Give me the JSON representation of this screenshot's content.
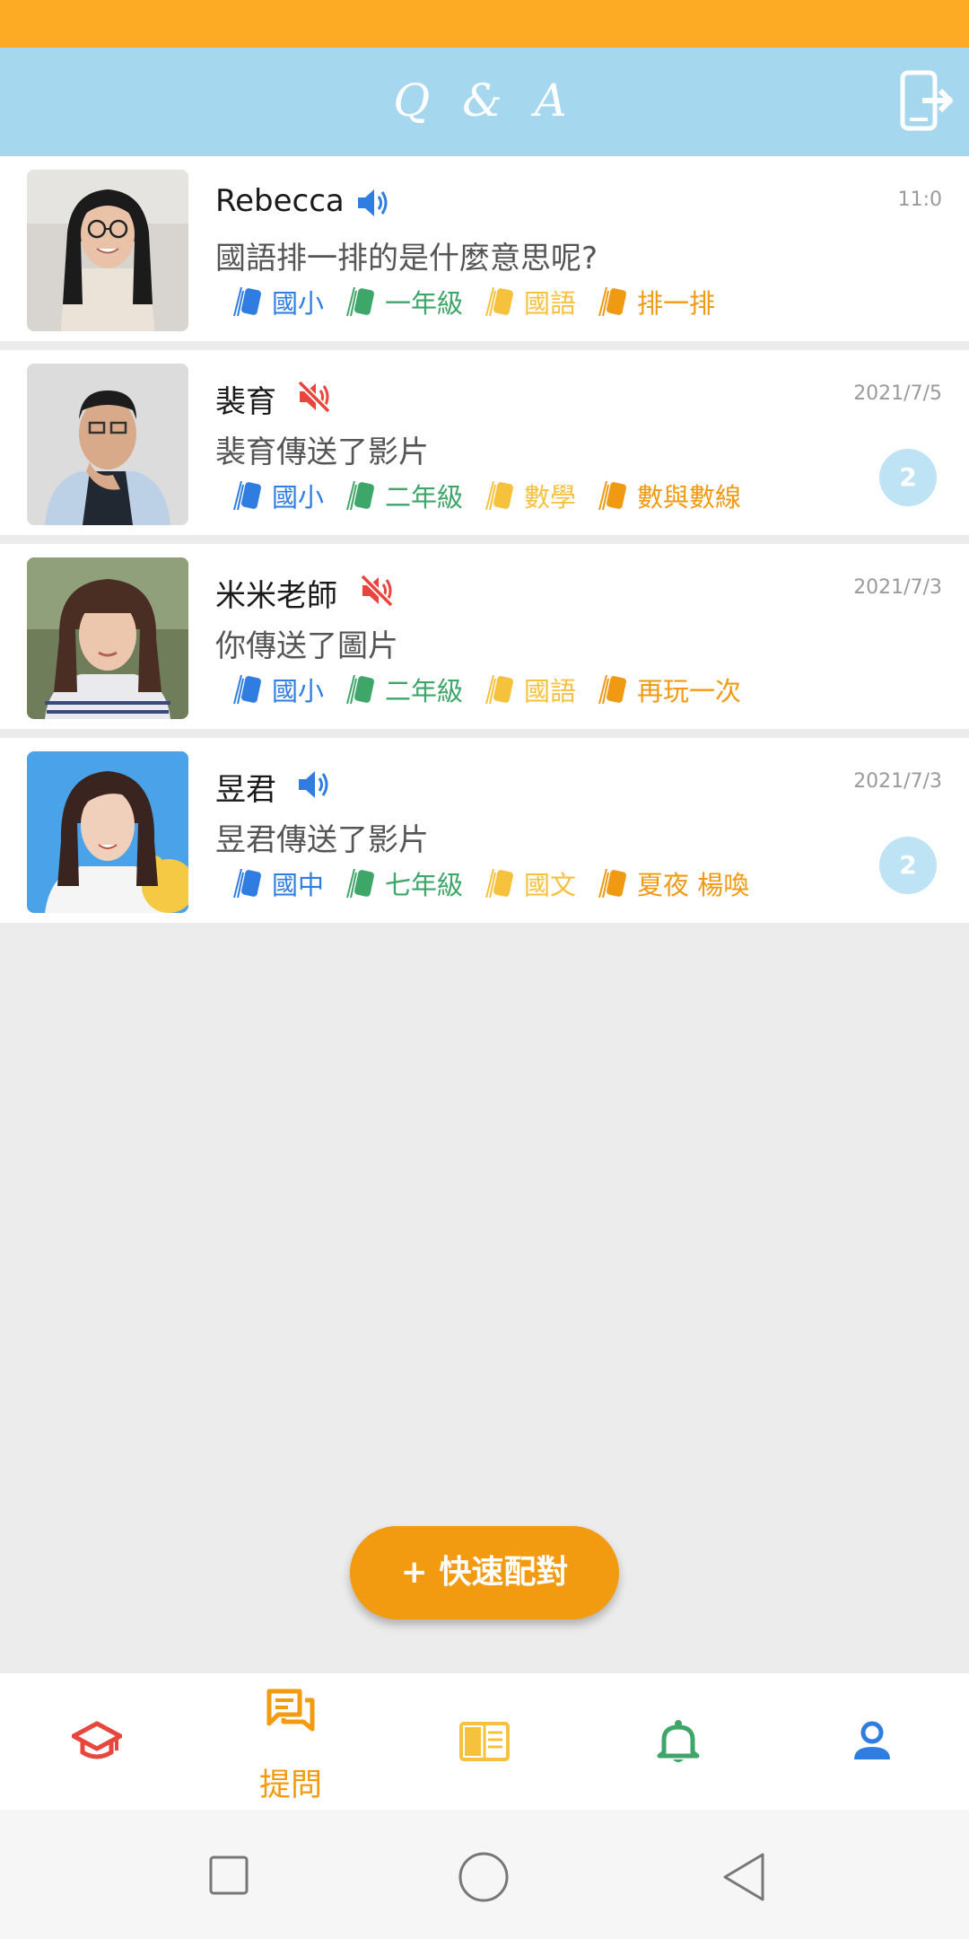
{
  "header": {
    "title": "Q & A"
  },
  "chats": [
    {
      "name": "Rebecca",
      "sound": "sound-on",
      "time": "11:0",
      "preview": "國語排一排的是什麼意思呢?",
      "tags": [
        "國小",
        "一年級",
        "國語",
        "排一排"
      ],
      "badge": ""
    },
    {
      "name": "裴育",
      "sound": "sound-off",
      "time": "2021/7/5",
      "preview": "裴育傳送了影片",
      "tags": [
        "國小",
        "二年級",
        "數學",
        "數與數線"
      ],
      "badge": "2"
    },
    {
      "name": "米米老師",
      "sound": "sound-off",
      "time": "2021/7/3",
      "preview": "你傳送了圖片",
      "tags": [
        "國小",
        "二年級",
        "國語",
        "再玩一次"
      ],
      "badge": ""
    },
    {
      "name": "昱君",
      "sound": "sound-on",
      "time": "2021/7/3",
      "preview": "昱君傳送了影片",
      "tags": [
        "國中",
        "七年級",
        "國文",
        "夏夜 楊喚"
      ],
      "badge": "2"
    }
  ],
  "tag_colors": [
    "#2f7de1",
    "#3fa66a",
    "#f6c13c",
    "#ef9a12"
  ],
  "fab": {
    "label": "+ 快速配對"
  },
  "bottom_nav": [
    {
      "icon": "graduation-cap-icon",
      "label": "",
      "color": "#e8453c"
    },
    {
      "icon": "chat-bubbles-icon",
      "label": "提問",
      "color": "#f39b10"
    },
    {
      "icon": "open-book-icon",
      "label": "",
      "color": "#f6c13c"
    },
    {
      "icon": "bell-icon",
      "label": "",
      "color": "#3fa66a"
    },
    {
      "icon": "person-icon",
      "label": "",
      "color": "#2f7de1"
    }
  ]
}
